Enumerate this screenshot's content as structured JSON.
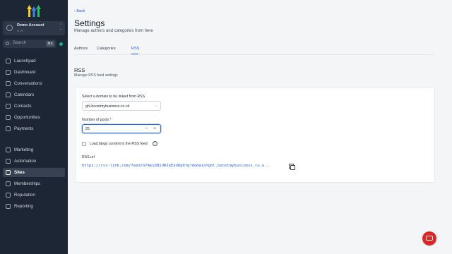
{
  "sidebar": {
    "account": {
      "name": "Demo Account",
      "sub": "A, A"
    },
    "search": {
      "placeholder": "Search",
      "shortcut": "⌘K"
    },
    "items": [
      {
        "label": "Launchpad"
      },
      {
        "label": "Dashboard"
      },
      {
        "label": "Conversations"
      },
      {
        "label": "Calendars"
      },
      {
        "label": "Contacts"
      },
      {
        "label": "Opportunities"
      },
      {
        "label": "Payments"
      },
      {
        "label": "Marketing"
      },
      {
        "label": "Automation"
      },
      {
        "label": "Sites"
      },
      {
        "label": "Memberships"
      },
      {
        "label": "Reputation"
      },
      {
        "label": "Reporting"
      }
    ],
    "active": "Sites"
  },
  "header": {
    "back": "Back",
    "title": "Settings",
    "subtitle": "Manage authors and categories from here"
  },
  "tabs": [
    {
      "label": "Authors"
    },
    {
      "label": "Categories"
    },
    {
      "label": "RSS"
    }
  ],
  "active_tab": "RSS",
  "section": {
    "title": "RSS",
    "subtitle": "Manage RSS feed settings"
  },
  "form": {
    "domain_label": "Select a domain to be linked from RSS",
    "domain_value": "ghl.boostmybusiness.co.uk",
    "posts_label": "Number of posts",
    "posts_required": "*",
    "posts_value": "25",
    "checkbox_label": "Load blogs content in the RSS feed",
    "rss_url_label": "RSS url",
    "rss_url": "https://rss-link.com/feed/GTAku3B1URJaEyUUg9fg?domain=ghl.boostmybusiness.co.u.."
  },
  "colors": {
    "accent": "#2563eb",
    "sidebar_bg": "#1d2634",
    "chat": "#dc2626"
  }
}
